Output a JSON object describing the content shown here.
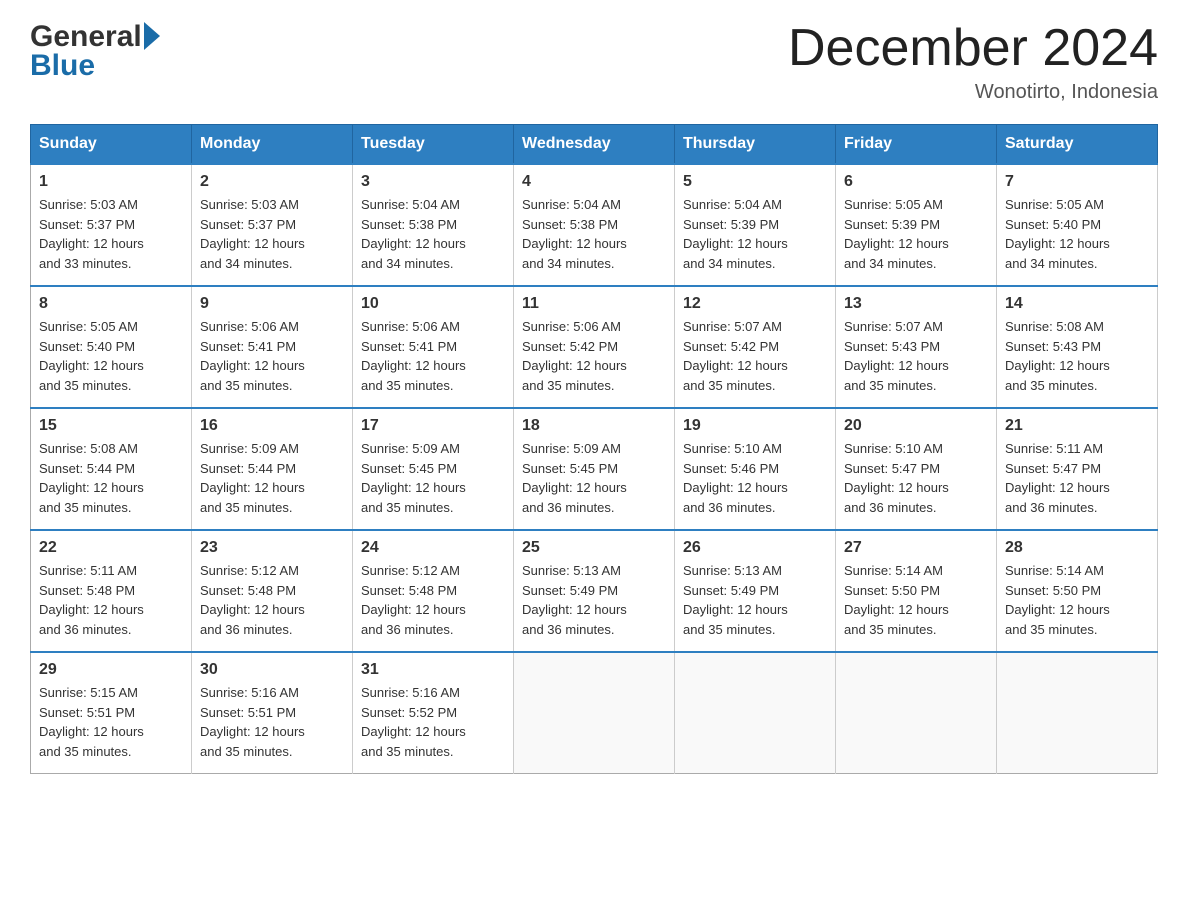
{
  "header": {
    "logo_line1": "General",
    "logo_line2": "Blue",
    "month_title": "December 2024",
    "location": "Wonotirto, Indonesia"
  },
  "days_of_week": [
    "Sunday",
    "Monday",
    "Tuesday",
    "Wednesday",
    "Thursday",
    "Friday",
    "Saturday"
  ],
  "weeks": [
    [
      {
        "day": "1",
        "sunrise": "5:03 AM",
        "sunset": "5:37 PM",
        "daylight": "12 hours and 33 minutes."
      },
      {
        "day": "2",
        "sunrise": "5:03 AM",
        "sunset": "5:37 PM",
        "daylight": "12 hours and 34 minutes."
      },
      {
        "day": "3",
        "sunrise": "5:04 AM",
        "sunset": "5:38 PM",
        "daylight": "12 hours and 34 minutes."
      },
      {
        "day": "4",
        "sunrise": "5:04 AM",
        "sunset": "5:38 PM",
        "daylight": "12 hours and 34 minutes."
      },
      {
        "day": "5",
        "sunrise": "5:04 AM",
        "sunset": "5:39 PM",
        "daylight": "12 hours and 34 minutes."
      },
      {
        "day": "6",
        "sunrise": "5:05 AM",
        "sunset": "5:39 PM",
        "daylight": "12 hours and 34 minutes."
      },
      {
        "day": "7",
        "sunrise": "5:05 AM",
        "sunset": "5:40 PM",
        "daylight": "12 hours and 34 minutes."
      }
    ],
    [
      {
        "day": "8",
        "sunrise": "5:05 AM",
        "sunset": "5:40 PM",
        "daylight": "12 hours and 35 minutes."
      },
      {
        "day": "9",
        "sunrise": "5:06 AM",
        "sunset": "5:41 PM",
        "daylight": "12 hours and 35 minutes."
      },
      {
        "day": "10",
        "sunrise": "5:06 AM",
        "sunset": "5:41 PM",
        "daylight": "12 hours and 35 minutes."
      },
      {
        "day": "11",
        "sunrise": "5:06 AM",
        "sunset": "5:42 PM",
        "daylight": "12 hours and 35 minutes."
      },
      {
        "day": "12",
        "sunrise": "5:07 AM",
        "sunset": "5:42 PM",
        "daylight": "12 hours and 35 minutes."
      },
      {
        "day": "13",
        "sunrise": "5:07 AM",
        "sunset": "5:43 PM",
        "daylight": "12 hours and 35 minutes."
      },
      {
        "day": "14",
        "sunrise": "5:08 AM",
        "sunset": "5:43 PM",
        "daylight": "12 hours and 35 minutes."
      }
    ],
    [
      {
        "day": "15",
        "sunrise": "5:08 AM",
        "sunset": "5:44 PM",
        "daylight": "12 hours and 35 minutes."
      },
      {
        "day": "16",
        "sunrise": "5:09 AM",
        "sunset": "5:44 PM",
        "daylight": "12 hours and 35 minutes."
      },
      {
        "day": "17",
        "sunrise": "5:09 AM",
        "sunset": "5:45 PM",
        "daylight": "12 hours and 35 minutes."
      },
      {
        "day": "18",
        "sunrise": "5:09 AM",
        "sunset": "5:45 PM",
        "daylight": "12 hours and 36 minutes."
      },
      {
        "day": "19",
        "sunrise": "5:10 AM",
        "sunset": "5:46 PM",
        "daylight": "12 hours and 36 minutes."
      },
      {
        "day": "20",
        "sunrise": "5:10 AM",
        "sunset": "5:47 PM",
        "daylight": "12 hours and 36 minutes."
      },
      {
        "day": "21",
        "sunrise": "5:11 AM",
        "sunset": "5:47 PM",
        "daylight": "12 hours and 36 minutes."
      }
    ],
    [
      {
        "day": "22",
        "sunrise": "5:11 AM",
        "sunset": "5:48 PM",
        "daylight": "12 hours and 36 minutes."
      },
      {
        "day": "23",
        "sunrise": "5:12 AM",
        "sunset": "5:48 PM",
        "daylight": "12 hours and 36 minutes."
      },
      {
        "day": "24",
        "sunrise": "5:12 AM",
        "sunset": "5:48 PM",
        "daylight": "12 hours and 36 minutes."
      },
      {
        "day": "25",
        "sunrise": "5:13 AM",
        "sunset": "5:49 PM",
        "daylight": "12 hours and 36 minutes."
      },
      {
        "day": "26",
        "sunrise": "5:13 AM",
        "sunset": "5:49 PM",
        "daylight": "12 hours and 35 minutes."
      },
      {
        "day": "27",
        "sunrise": "5:14 AM",
        "sunset": "5:50 PM",
        "daylight": "12 hours and 35 minutes."
      },
      {
        "day": "28",
        "sunrise": "5:14 AM",
        "sunset": "5:50 PM",
        "daylight": "12 hours and 35 minutes."
      }
    ],
    [
      {
        "day": "29",
        "sunrise": "5:15 AM",
        "sunset": "5:51 PM",
        "daylight": "12 hours and 35 minutes."
      },
      {
        "day": "30",
        "sunrise": "5:16 AM",
        "sunset": "5:51 PM",
        "daylight": "12 hours and 35 minutes."
      },
      {
        "day": "31",
        "sunrise": "5:16 AM",
        "sunset": "5:52 PM",
        "daylight": "12 hours and 35 minutes."
      },
      null,
      null,
      null,
      null
    ]
  ],
  "labels": {
    "sunrise": "Sunrise:",
    "sunset": "Sunset:",
    "daylight": "Daylight:"
  }
}
